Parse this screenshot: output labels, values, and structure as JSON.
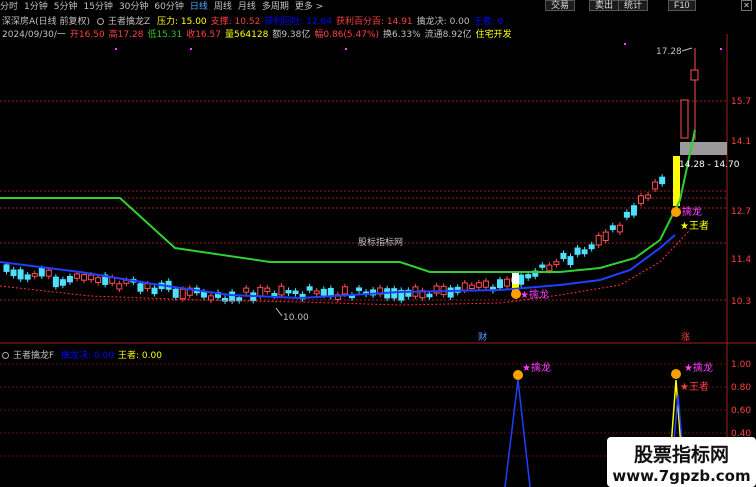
{
  "toolbar": {
    "periods": [
      "分时",
      "1分钟",
      "5分钟",
      "15分钟",
      "30分钟",
      "60分钟",
      "日线",
      "周线",
      "月线",
      "多周期",
      "更多 >"
    ],
    "active_period": "日线",
    "buttons": {
      "trade": "交易",
      "sell": "卖出",
      "stats": "统计",
      "f10": "F10"
    },
    "close_label": "✕"
  },
  "header": {
    "stock_name": "深深房A",
    "mode": "(日线 前复权)",
    "indicator_name": "王者擒龙Z",
    "stats": [
      {
        "label": "压力: 15.00",
        "color": "#ffff00"
      },
      {
        "label": "支撑: 10.52",
        "color": "#ff4040"
      },
      {
        "label": "获利回吐: 12.64",
        "color": "#0000ff"
      },
      {
        "label": "获利百分百: 14.91",
        "color": "#ff4040"
      },
      {
        "label": "擒龙决: 0.00",
        "color": "#c0c0c0"
      },
      {
        "label": "王者: 0",
        "color": "#0000ff"
      }
    ]
  },
  "quote": {
    "items": [
      {
        "label": "2024/09/30/一",
        "color": "#c0c0c0"
      },
      {
        "label": "开16.50",
        "color": "#ff4040"
      },
      {
        "label": "高17.28",
        "color": "#ff4040"
      },
      {
        "label": "低15.31",
        "color": "#30c030"
      },
      {
        "label": "收16.57",
        "color": "#ff4040"
      },
      {
        "label": "量564128",
        "color": "#ffff00"
      },
      {
        "label": "额9.38亿",
        "color": "#c0c0c0"
      },
      {
        "label": "幅0.86(5.47%)",
        "color": "#ff4040"
      },
      {
        "label": "换6.33%",
        "color": "#c0c0c0"
      },
      {
        "label": "流通8.92亿",
        "color": "#c0c0c0"
      },
      {
        "label": "住宅开发",
        "color": "#ffff00"
      }
    ]
  },
  "subchart": {
    "title": "王者擒龙F",
    "items": [
      {
        "label": "擒龙决: 0.00",
        "color": "#0000ff"
      },
      {
        "label": "王者: 0.00",
        "color": "#ffff00"
      }
    ]
  },
  "chart_data": {
    "type": "candlestick",
    "price_axis_ticks": [
      "15.7",
      "14.1",
      "12.7",
      "11.4",
      "10.3"
    ],
    "sub_axis_ticks": [
      "1.00",
      "0.80",
      "0.60",
      "0.40",
      "0.20"
    ],
    "annotations": {
      "high_label": "17.28",
      "low_label": "10.00",
      "range_label": "14.28 - 14.70",
      "watermark": "股标指标网",
      "signal_labels": [
        "擒龙",
        "王者"
      ],
      "finance_marker": "财",
      "rise_marker": "涨"
    }
  },
  "logo": {
    "title": "股票指标网",
    "url": "www.7gpzb.com"
  }
}
